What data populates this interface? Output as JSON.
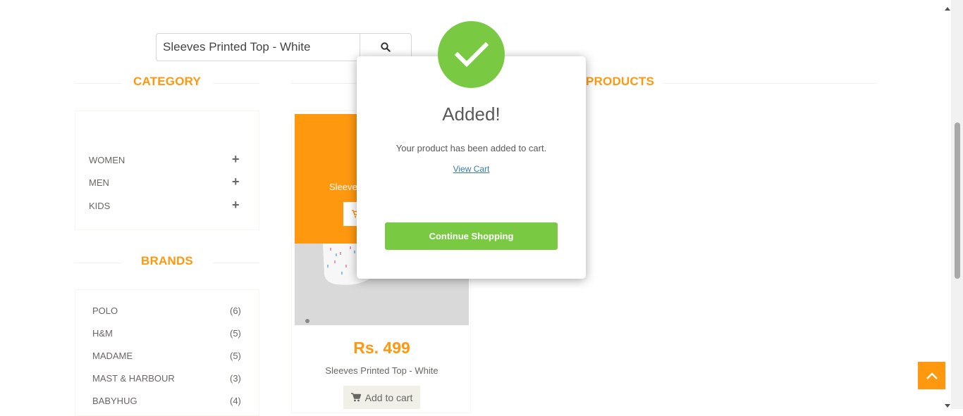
{
  "search": {
    "value": "Sleeves Printed Top - White",
    "button_icon": "search-icon"
  },
  "category": {
    "title": "CATEGORY",
    "items": [
      {
        "label": "WOMEN",
        "expand": "+"
      },
      {
        "label": "MEN",
        "expand": "+"
      },
      {
        "label": "KIDS",
        "expand": "+"
      }
    ]
  },
  "brands": {
    "title": "BRANDS",
    "items": [
      {
        "name": "POLO",
        "count": "(6)"
      },
      {
        "name": "H&M",
        "count": "(5)"
      },
      {
        "name": "MADAME",
        "count": "(5)"
      },
      {
        "name": "MAST & HARBOUR",
        "count": "(3)"
      },
      {
        "name": "BABYHUG",
        "count": "(4)"
      }
    ]
  },
  "products": {
    "title": "PRODUCTS",
    "item": {
      "overlay_name": "Sleeves",
      "price": "Rs. 499",
      "name": "Sleeves Printed Top - White",
      "add_to_cart": "Add to cart"
    }
  },
  "modal": {
    "title": "Added!",
    "message": "Your product has been added to cart.",
    "link": "View Cart",
    "continue_label": "Continue Shopping"
  },
  "colors": {
    "accent": "#fe980f",
    "success": "#7ac943",
    "text": "#696763"
  }
}
